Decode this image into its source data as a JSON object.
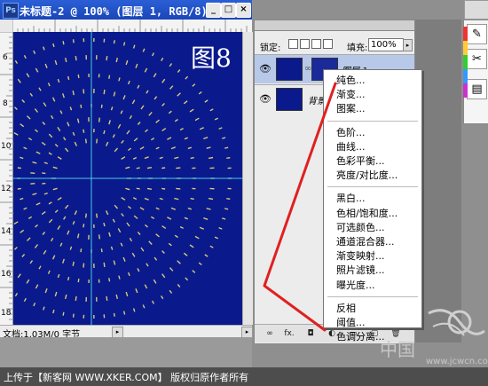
{
  "window": {
    "title": "未标题-2 @ 100% (图层 1, RGB/8)",
    "app_icon_text": "Ps",
    "minimize_label": "_",
    "maximize_label": "□",
    "close_label": "×"
  },
  "rulers": {
    "top_numbers": [
      "0",
      "2",
      "4",
      "6",
      "8",
      "10",
      "12",
      "14"
    ],
    "left_numbers": [
      "6",
      "8",
      "10",
      "12",
      "14",
      "16",
      "18"
    ]
  },
  "canvas": {
    "figure_label": "图8",
    "background_color": "#0a1a8c",
    "dash_color": "#d7c878"
  },
  "status_bar": {
    "doc_info": "文档:1.03M/0 字节",
    "nav_arrow": "▸"
  },
  "layers_panel": {
    "lock_label": "锁定:",
    "fill_label": "填充:",
    "fill_value": "100%",
    "fill_arrow": "▸",
    "layers": [
      {
        "name": "图层 1",
        "visible_icon": "eye-icon",
        "selected": true,
        "has_mask": true
      },
      {
        "name": "背景",
        "visible_icon": "eye-icon",
        "selected": false,
        "has_mask": false
      }
    ],
    "bottom_icons": [
      "link-icon",
      "fx-icon",
      "mask-icon",
      "adjustment-icon",
      "folder-icon",
      "new-layer-icon",
      "trash-icon"
    ],
    "bottom_labels": {
      "link": "∞",
      "fx": "fx.",
      "mask": "◘",
      "adjust": "◐",
      "folder": "▭",
      "new": "▢",
      "trash": "🗑"
    }
  },
  "context_menu": {
    "groups": [
      [
        "纯色...",
        "渐变...",
        "图案..."
      ],
      [
        "色阶...",
        "曲线...",
        "色彩平衡...",
        "亮度/对比度..."
      ],
      [
        "黑白...",
        "色相/饱和度...",
        "可选颜色...",
        "通道混合器...",
        "渐变映射...",
        "照片滤镜...",
        "曝光度..."
      ],
      [
        "反相",
        "阈值...",
        "色调分离..."
      ]
    ]
  },
  "annotation": {
    "stroke_color": "#e02020"
  },
  "toolbox": {
    "tools": [
      {
        "icon": "brush-icon",
        "glyph": "✎"
      },
      {
        "icon": "scissors-icon",
        "glyph": "✂"
      },
      {
        "icon": "panel-icon",
        "glyph": "▤"
      }
    ]
  },
  "footer": {
    "credit": "上传于【新客网 WWW.XKER.COM】 版权归原作者所有"
  },
  "watermark": {
    "text_cn": "中国",
    "url": "www.jcwcn.com"
  }
}
